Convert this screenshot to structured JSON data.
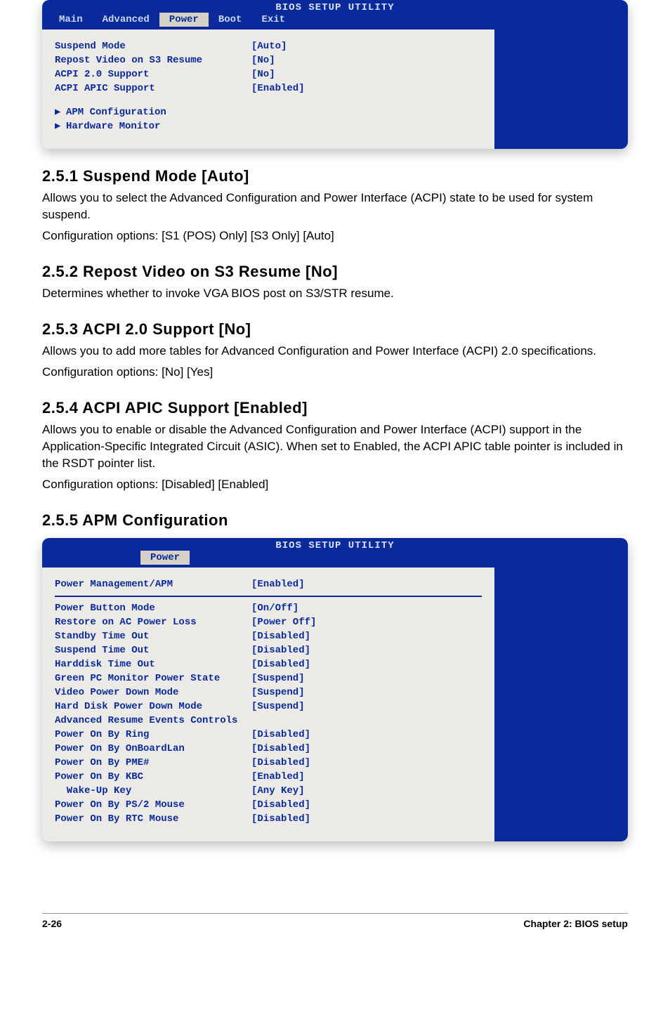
{
  "bios1": {
    "title": "BIOS SETUP UTILITY",
    "tabs": {
      "main": "Main",
      "advanced": "Advanced",
      "power": "Power",
      "boot": "Boot",
      "exit": "Exit"
    },
    "rows": [
      {
        "label": "Suspend Mode",
        "value": "[Auto]"
      },
      {
        "label": "Repost Video on S3 Resume",
        "value": "[No]"
      },
      {
        "label": "ACPI 2.0 Support",
        "value": "[No]"
      },
      {
        "label": "ACPI APIC Support",
        "value": "[Enabled]"
      }
    ],
    "sub": [
      "APM Configuration",
      "Hardware Monitor"
    ]
  },
  "sections": {
    "s251": {
      "h": "2.5.1   Suspend Mode [Auto]",
      "p1": "Allows you to select the Advanced Configuration and Power Interface (ACPI) state to be used for system suspend.",
      "p2": "Configuration options: [S1 (POS) Only] [S3 Only] [Auto]"
    },
    "s252": {
      "h": "2.5.2   Repost Video on S3 Resume [No]",
      "p1": "Determines whether to invoke VGA BIOS post on S3/STR resume."
    },
    "s253": {
      "h": "2.5.3   ACPI 2.0 Support [No]",
      "p1": "Allows you to add more tables for Advanced Configuration and Power Interface (ACPI) 2.0 specifications.",
      "p2": "Configuration options: [No] [Yes]"
    },
    "s254": {
      "h": "2.5.4   ACPI APIC Support [Enabled]",
      "p1": "Allows you to enable or disable the Advanced Configuration and Power Interface (ACPI) support in the Application-Specific Integrated Circuit (ASIC). When set to Enabled, the ACPI APIC table pointer is included in the RSDT pointer list.",
      "p2": "Configuration options: [Disabled] [Enabled]"
    },
    "s255": {
      "h": "2.5.5   APM Configuration"
    }
  },
  "bios2": {
    "title": "BIOS SETUP UTILITY",
    "tab": "Power",
    "header": {
      "label": "Power Management/APM",
      "value": "[Enabled]"
    },
    "rows": [
      {
        "label": "Power Button Mode",
        "value": "[On/Off]"
      },
      {
        "label": "Restore on AC Power Loss",
        "value": "[Power Off]"
      },
      {
        "label": "Standby Time Out",
        "value": "[Disabled]"
      },
      {
        "label": "Suspend Time Out",
        "value": "[Disabled]"
      },
      {
        "label": "Harddisk Time Out",
        "value": "[Disabled]"
      },
      {
        "label": "Green PC Monitor Power State",
        "value": "[Suspend]"
      },
      {
        "label": "Video Power Down Mode",
        "value": "[Suspend]"
      },
      {
        "label": "Hard Disk Power Down Mode",
        "value": "[Suspend]"
      },
      {
        "label": "Advanced Resume Events Controls",
        "value": ""
      },
      {
        "label": "Power On By Ring",
        "value": "[Disabled]"
      },
      {
        "label": "Power On By OnBoardLan",
        "value": "[Disabled]"
      },
      {
        "label": "Power On By PME#",
        "value": "[Disabled]"
      },
      {
        "label": "Power On By KBC",
        "value": "[Enabled]"
      },
      {
        "label": "  Wake-Up Key",
        "value": "[Any Key]"
      },
      {
        "label": "Power On By PS/2 Mouse",
        "value": "[Disabled]"
      },
      {
        "label": "Power On By RTC Mouse",
        "value": "[Disabled]"
      }
    ]
  },
  "footer": {
    "left": "2-26",
    "right": "Chapter 2: BIOS setup"
  }
}
